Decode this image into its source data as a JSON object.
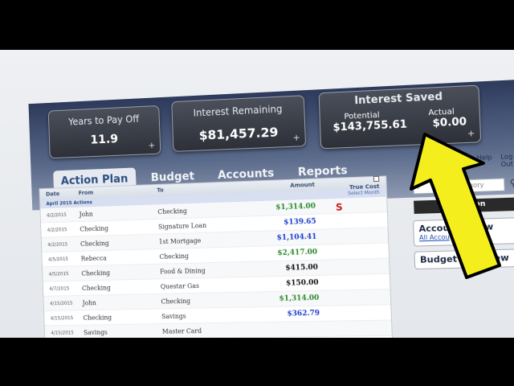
{
  "stats": {
    "years": {
      "label": "Years to Pay Off",
      "value": "11.9"
    },
    "interest_remaining": {
      "label": "Interest Remaining",
      "value": "$81,457.29"
    },
    "interest_saved": {
      "label": "Interest Saved",
      "potential_label": "Potential",
      "potential_value": "$143,755.61",
      "actual_label": "Actual",
      "actual_value": "$0.00"
    },
    "plus": "+"
  },
  "tabs": [
    "Action Plan",
    "Budget",
    "Accounts",
    "Reports"
  ],
  "table": {
    "headers": {
      "date": "Date",
      "from": "From",
      "to": "To",
      "amount": "Amount",
      "true_cost": "True Cost"
    },
    "month_label": "April 2015 Actions",
    "select_month": "Select Month",
    "rows": [
      {
        "date": "4/2/2015",
        "from": "John",
        "to": "Checking",
        "amount": "$1,314.00",
        "kind": "pos"
      },
      {
        "date": "4/2/2015",
        "from": "Checking",
        "to": "Signature Loan",
        "amount": "$139.65",
        "kind": "neg"
      },
      {
        "date": "4/2/2015",
        "from": "Checking",
        "to": "1st Mortgage",
        "amount": "$1,104.41",
        "kind": "neg"
      },
      {
        "date": "4/5/2015",
        "from": "Rebecca",
        "to": "Checking",
        "amount": "$2,417.00",
        "kind": "pos"
      },
      {
        "date": "4/5/2015",
        "from": "Checking",
        "to": "Food & Dining",
        "amount": "$415.00",
        "kind": "blk"
      },
      {
        "date": "4/7/2015",
        "from": "Checking",
        "to": "Questar Gas",
        "amount": "$150.00",
        "kind": "blk"
      },
      {
        "date": "4/15/2015",
        "from": "John",
        "to": "Checking",
        "amount": "$1,314.00",
        "kind": "pos"
      },
      {
        "date": "4/15/2015",
        "from": "Checking",
        "to": "Savings",
        "amount": "$362.79",
        "kind": "neg"
      },
      {
        "date": "4/15/2015",
        "from": "Savings",
        "to": "Master Card",
        "amount": "",
        "kind": "neg"
      }
    ]
  },
  "sidebar": {
    "links": [
      "Help",
      "Log Out"
    ],
    "search_placeholder": "F",
    "category_placeholder": "ategory",
    "action_button": "Action",
    "account_overview": {
      "title": "Accou     verview",
      "link": "All Accou"
    },
    "budget_overview": {
      "title": "Budget Overview"
    }
  },
  "colors": {
    "arrow": "#f4ef1c",
    "positive": "#2b8a2b",
    "negative": "#1a3ccf"
  }
}
